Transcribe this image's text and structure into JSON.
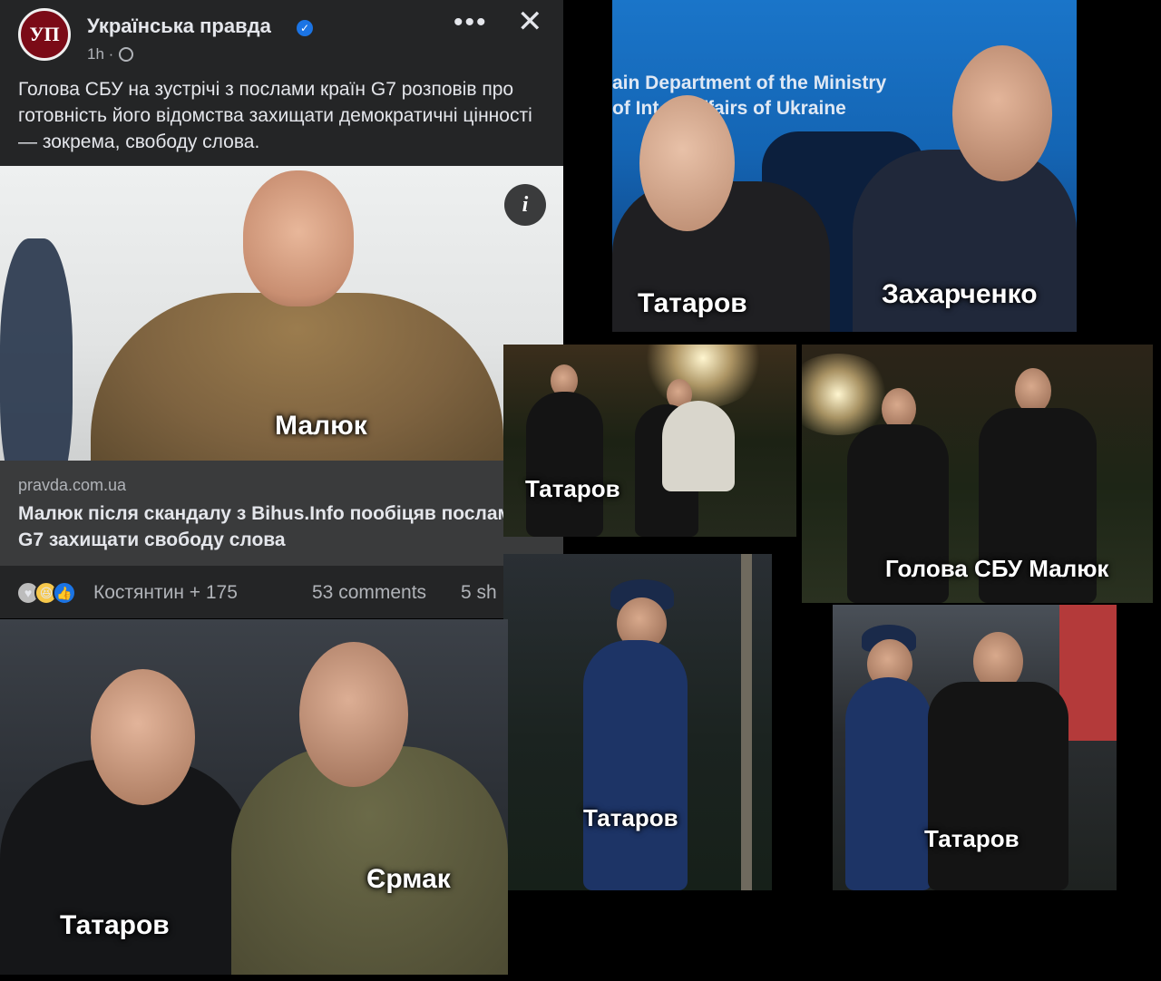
{
  "post": {
    "page_name": "Українська правда",
    "avatar_text": "УП",
    "time": "1h ·",
    "text": "Голова СБУ на зустрічі з послами країн G7 розповів про готовність його відомства захищати демократичні цінності — зокрема, свободу слова.",
    "image_caption": "Малюк",
    "link_domain": "pravda.com.ua",
    "link_title": "Малюк після скандалу з Bihus.Info пообіцяв послам G7 захищати свободу слова",
    "reactors": "Костянтин + 175",
    "comments": "53 comments",
    "shares": "5 sh",
    "icons": [
      "verified-icon",
      "globe-icon",
      "more-icon",
      "close-icon",
      "info-icon",
      "care-reaction-icon",
      "haha-reaction-icon",
      "like-reaction-icon"
    ]
  },
  "collage": {
    "zakharchenko_photo": {
      "sign_line1": "ain Department of the Ministry",
      "sign_line2": "of Int        ffairs of Ukraine",
      "caption_left": "Татаров",
      "caption_right": "Захарченко"
    },
    "night_photo_1": {
      "caption": "Татаров"
    },
    "night_photo_2": {
      "caption": "Голова СБУ Малюк"
    },
    "night_photo_3": {
      "caption": "Татаров"
    },
    "night_photo_4": {
      "caption": "Татаров"
    },
    "ermak_photo": {
      "caption_left": "Татаров",
      "caption_right": "Єрмак"
    }
  },
  "colors": {
    "card_bg": "#242526",
    "link_preview_bg": "#3a3b3c",
    "verified_blue": "#1b74e4",
    "text_primary": "#e4e6eb",
    "text_secondary": "#b0b3b8"
  }
}
